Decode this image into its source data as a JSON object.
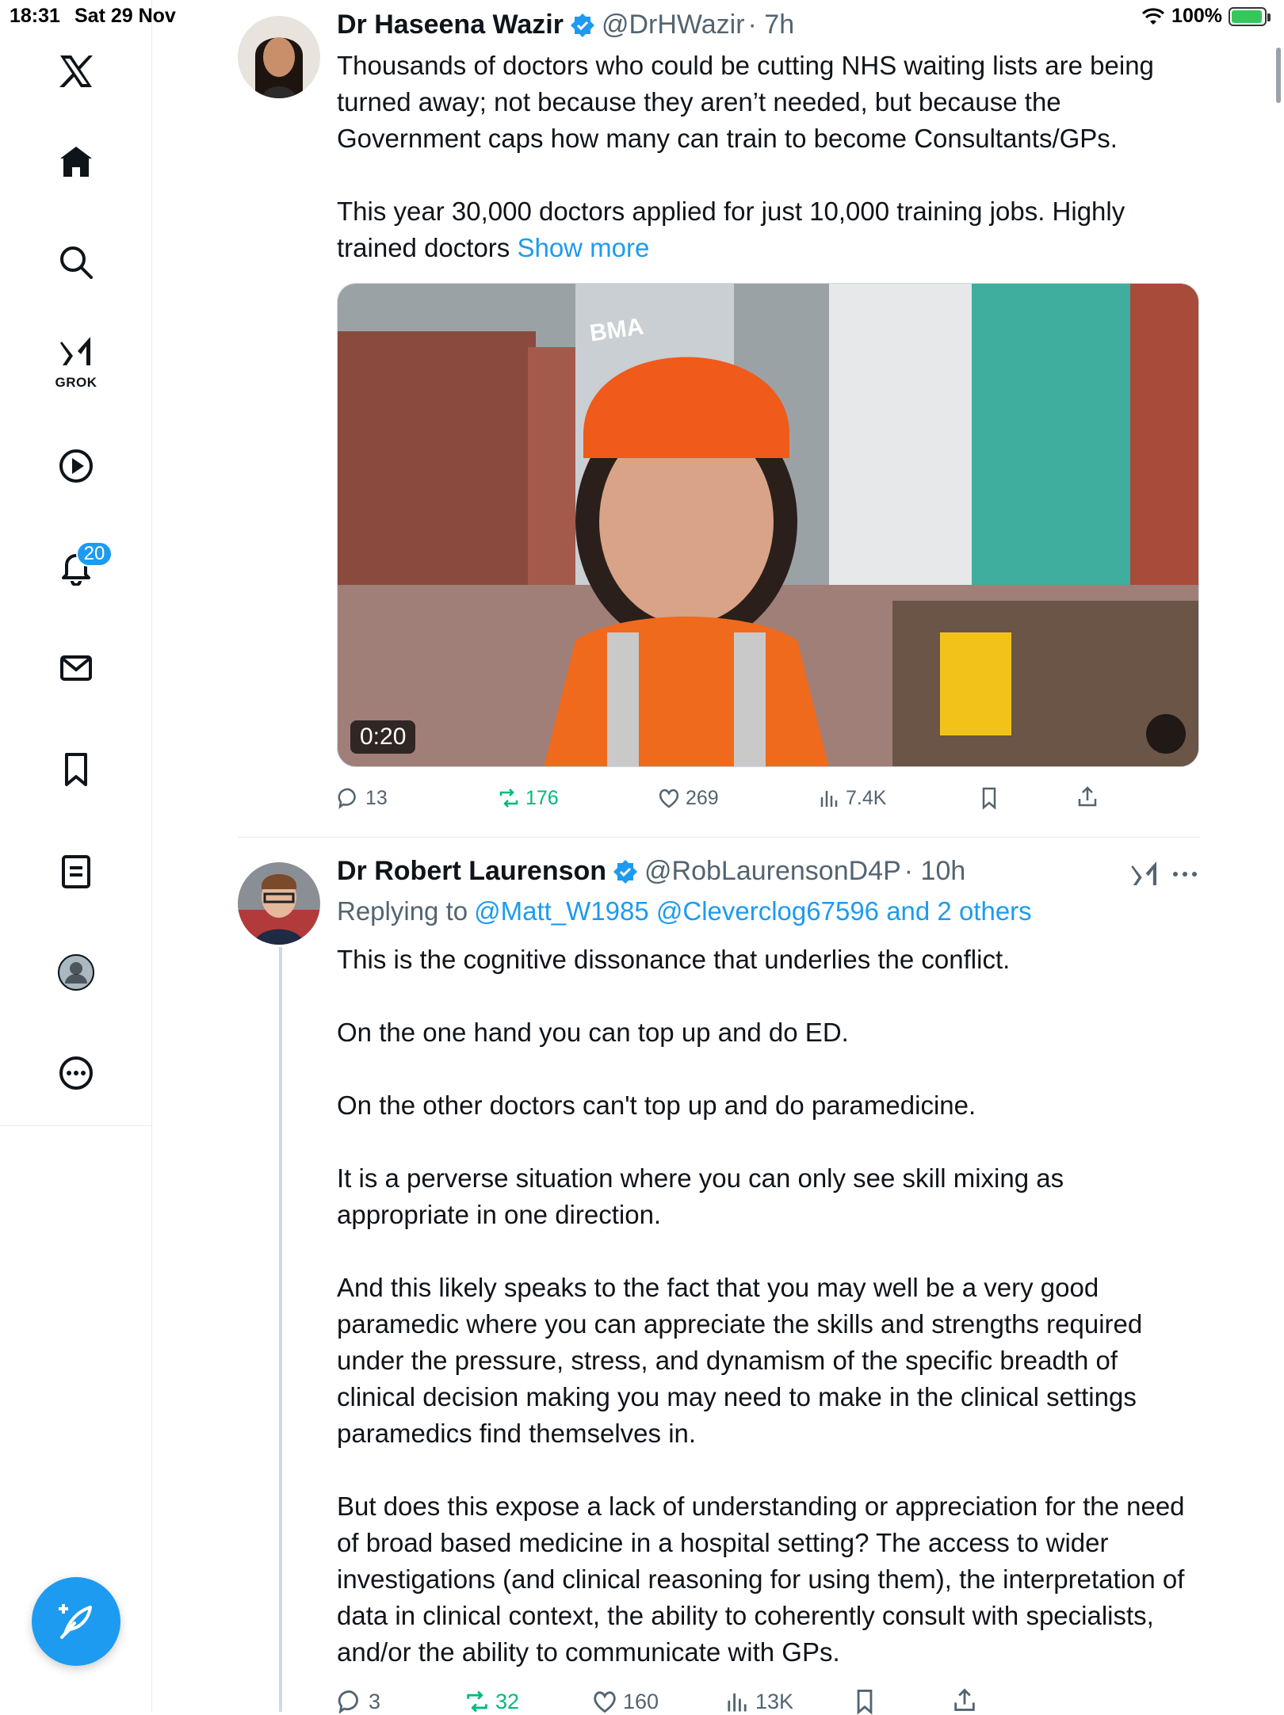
{
  "status_bar": {
    "time": "18:31",
    "date": "Sat 29 Nov",
    "battery": "100%"
  },
  "sidebar": {
    "grok_label": "GROK",
    "notification_count": "20"
  },
  "tweet1": {
    "display_name": "Dr Haseena Wazir",
    "handle": "@DrHWazir",
    "time": "· 7h",
    "text": "Thousands of doctors who could be cutting NHS waiting lists are being turned away; not because they aren’t needed, but because the Government caps how many can train to become Consultants/GPs.\n\nThis year 30,000 doctors applied for just 10,000 training jobs. Highly trained doctors",
    "show_more": "Show more",
    "video_duration": "0:20",
    "video_hat_text": "BMA",
    "replies": "13",
    "retweets": "176",
    "likes": "269",
    "views": "7.4K"
  },
  "tweet2": {
    "display_name": "Dr Robert Laurenson",
    "handle": "@RobLaurensonD4P",
    "time": "· 10h",
    "replying_prefix": "Replying to",
    "replying_users": "@Matt_W1985 @Cleverclog67596 and 2 others",
    "text": "This is the cognitive dissonance that underlies the conflict.\n\nOn the one hand you can top up and do ED.\n\nOn the other doctors can't top up and do paramedicine.\n\nIt is a perverse situation where you can only see skill mixing as appropriate in one direction.\n\nAnd this likely speaks to the fact that you may well be a very good paramedic where you can appreciate the skills and strengths required under the pressure, stress, and dynamism of the specific breadth of clinical decision making you may need to make in the clinical settings paramedics find themselves in.\n\nBut does this expose a lack of understanding or appreciation for the need of broad based medicine in a hospital setting? The access to wider investigations (and clinical reasoning for using them), the interpretation of data in clinical context, the ability to coherently consult with specialists, and/or the ability to communicate with GPs.",
    "replies": "3",
    "retweets": "32",
    "likes": "160",
    "views": "13K"
  },
  "colors": {
    "accent": "#1d9bf0",
    "retweet_green": "#00ba7c",
    "muted": "#536471",
    "border": "#e7e9ea"
  }
}
